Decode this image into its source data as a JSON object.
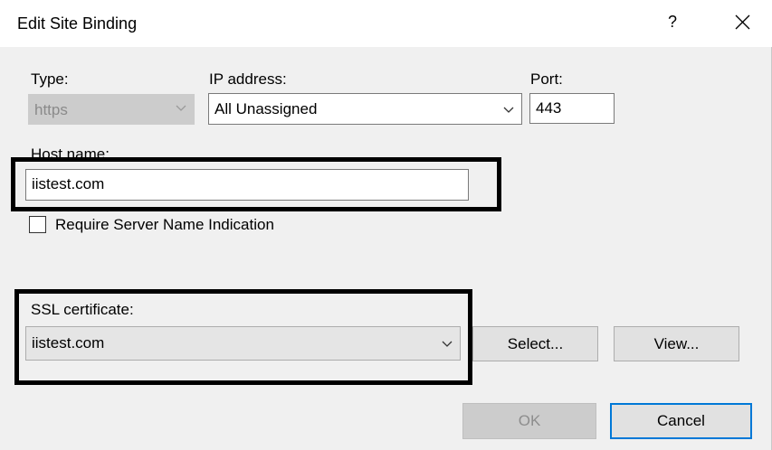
{
  "dialog": {
    "title": "Edit Site Binding",
    "help_glyph": "?",
    "close_glyph": "close"
  },
  "type": {
    "label": "Type:",
    "value": "https"
  },
  "ip": {
    "label": "IP address:",
    "value": "All Unassigned"
  },
  "port": {
    "label": "Port:",
    "value": "443"
  },
  "host": {
    "label": "Host name:",
    "value": "iistest.com"
  },
  "sni": {
    "label": "Require Server Name Indication",
    "checked": false
  },
  "ssl": {
    "label": "SSL certificate:",
    "value": "iistest.com",
    "select_label": "Select...",
    "view_label": "View..."
  },
  "footer": {
    "ok_label": "OK",
    "cancel_label": "Cancel"
  }
}
